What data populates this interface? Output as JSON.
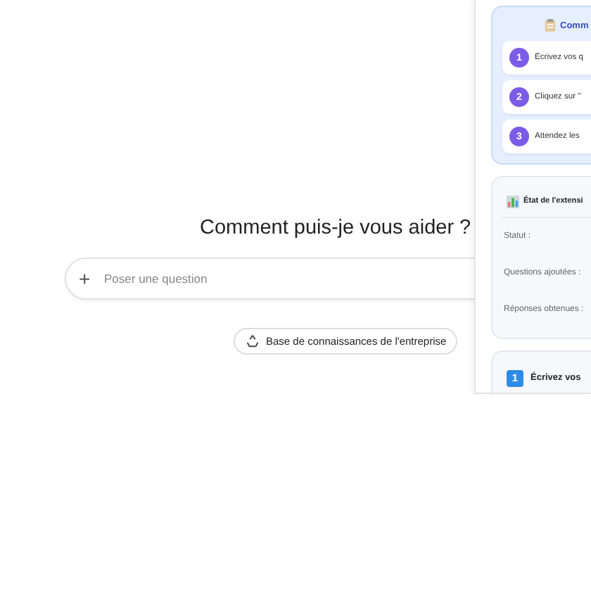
{
  "main": {
    "heading": "Comment puis-je vous aider ?",
    "input": {
      "icon": "+",
      "placeholder": "Poser une question"
    },
    "chip": "Base de connaissances de l'entreprise"
  },
  "panel": {
    "guide": {
      "title": "Comm",
      "steps": [
        {
          "number": "1",
          "text": "Écrivez vos q"
        },
        {
          "number": "2",
          "text": "Cliquez sur \""
        },
        {
          "number": "3",
          "text": "Attendez les"
        }
      ]
    },
    "status": {
      "title": "État de l'extensi",
      "rows": [
        {
          "label": "Statut :"
        },
        {
          "label": "Questions ajoutées :"
        },
        {
          "label": "Réponses obtenues :"
        }
      ]
    },
    "step_card": {
      "number": "1",
      "title": "Écrivez vos"
    }
  }
}
